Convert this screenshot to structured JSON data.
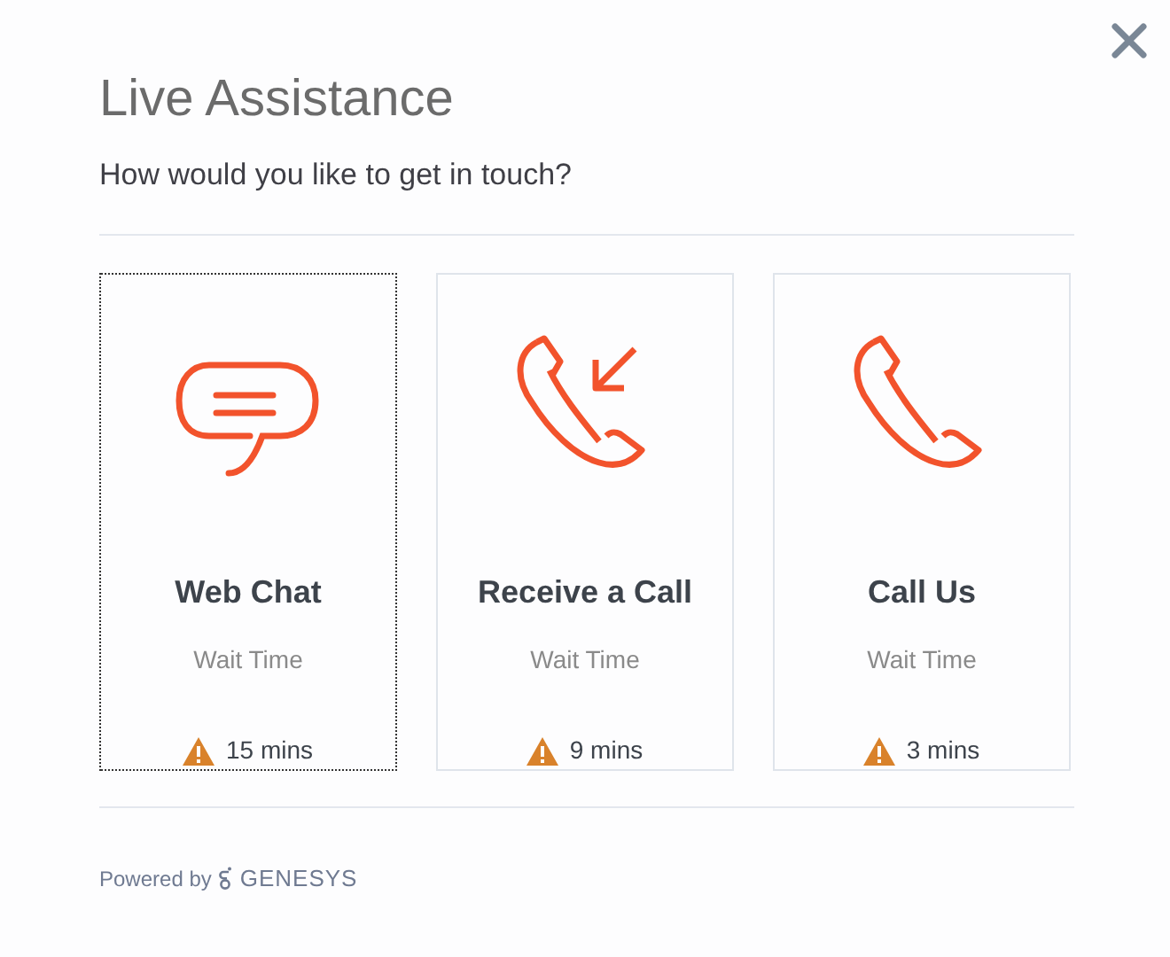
{
  "dialog": {
    "title": "Live Assistance",
    "question": "How would you like to get in touch?"
  },
  "options": [
    {
      "kind": "chat",
      "label": "Web Chat",
      "wait_label": "Wait Time",
      "wait": "15 mins",
      "selected": true
    },
    {
      "kind": "callback",
      "label": "Receive a Call",
      "wait_label": "Wait Time",
      "wait": "9 mins",
      "selected": false
    },
    {
      "kind": "call",
      "label": "Call Us",
      "wait_label": "Wait Time",
      "wait": "3 mins",
      "selected": false
    }
  ],
  "footer": {
    "powered_by": "Powered by",
    "brand": "GENESYS"
  }
}
